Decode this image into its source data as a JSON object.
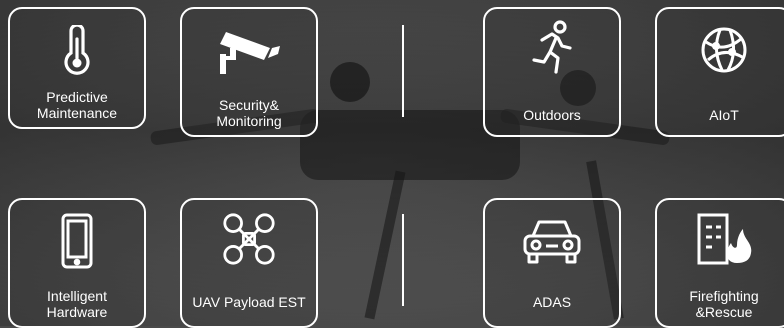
{
  "tiles": [
    {
      "label": "Predictive\nMaintenance",
      "icon": "thermometer-icon"
    },
    {
      "label": "Security&\nMonitoring",
      "icon": "security-camera-icon"
    },
    {
      "label": "Outdoors",
      "icon": "running-person-icon"
    },
    {
      "label": "AIoT",
      "icon": "globe-network-icon"
    },
    {
      "label": "Intelligent\nHardware",
      "icon": "smartphone-icon"
    },
    {
      "label": "UAV Payload EST",
      "icon": "drone-icon"
    },
    {
      "label": "ADAS",
      "icon": "car-icon"
    },
    {
      "label": "Firefighting\n&Rescue",
      "icon": "building-fire-icon"
    }
  ],
  "colors": {
    "tile_border": "#ffffff",
    "text": "#ffffff"
  }
}
